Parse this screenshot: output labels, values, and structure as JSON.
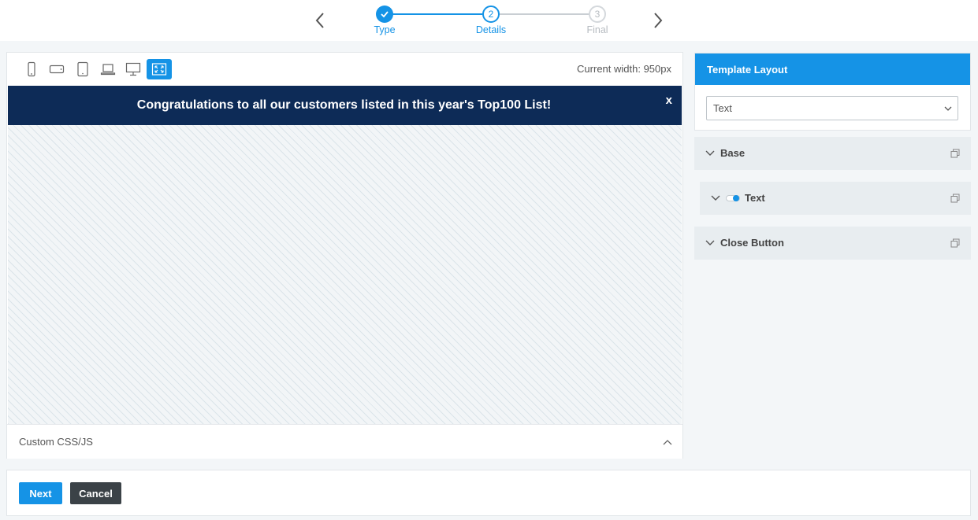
{
  "wizard": {
    "steps": [
      {
        "number": "",
        "label": "Type",
        "state": "complete"
      },
      {
        "number": "2",
        "label": "Details",
        "state": "active"
      },
      {
        "number": "3",
        "label": "Final",
        "state": "inactive"
      }
    ]
  },
  "preview": {
    "devices": [
      "mobile-portrait-icon",
      "mobile-landscape-icon",
      "tablet-icon",
      "laptop-icon",
      "desktop-icon",
      "fullscreen-icon"
    ],
    "current_width_text": "Current width: 950px",
    "banner": {
      "text": "Congratulations to all our customers listed in this year's Top100 List!",
      "close": "x",
      "background": "#0d2b57"
    },
    "custom_css_label": "Custom CSS/JS"
  },
  "sidebar": {
    "template_layout": {
      "title": "Template Layout",
      "selected": "Text"
    },
    "sections": [
      {
        "label": "Base"
      },
      {
        "label": "Text"
      },
      {
        "label": "Close Button"
      }
    ]
  },
  "footer": {
    "next_label": "Next",
    "cancel_label": "Cancel"
  },
  "colors": {
    "accent": "#1593e6",
    "dark_button": "#3b4247"
  }
}
